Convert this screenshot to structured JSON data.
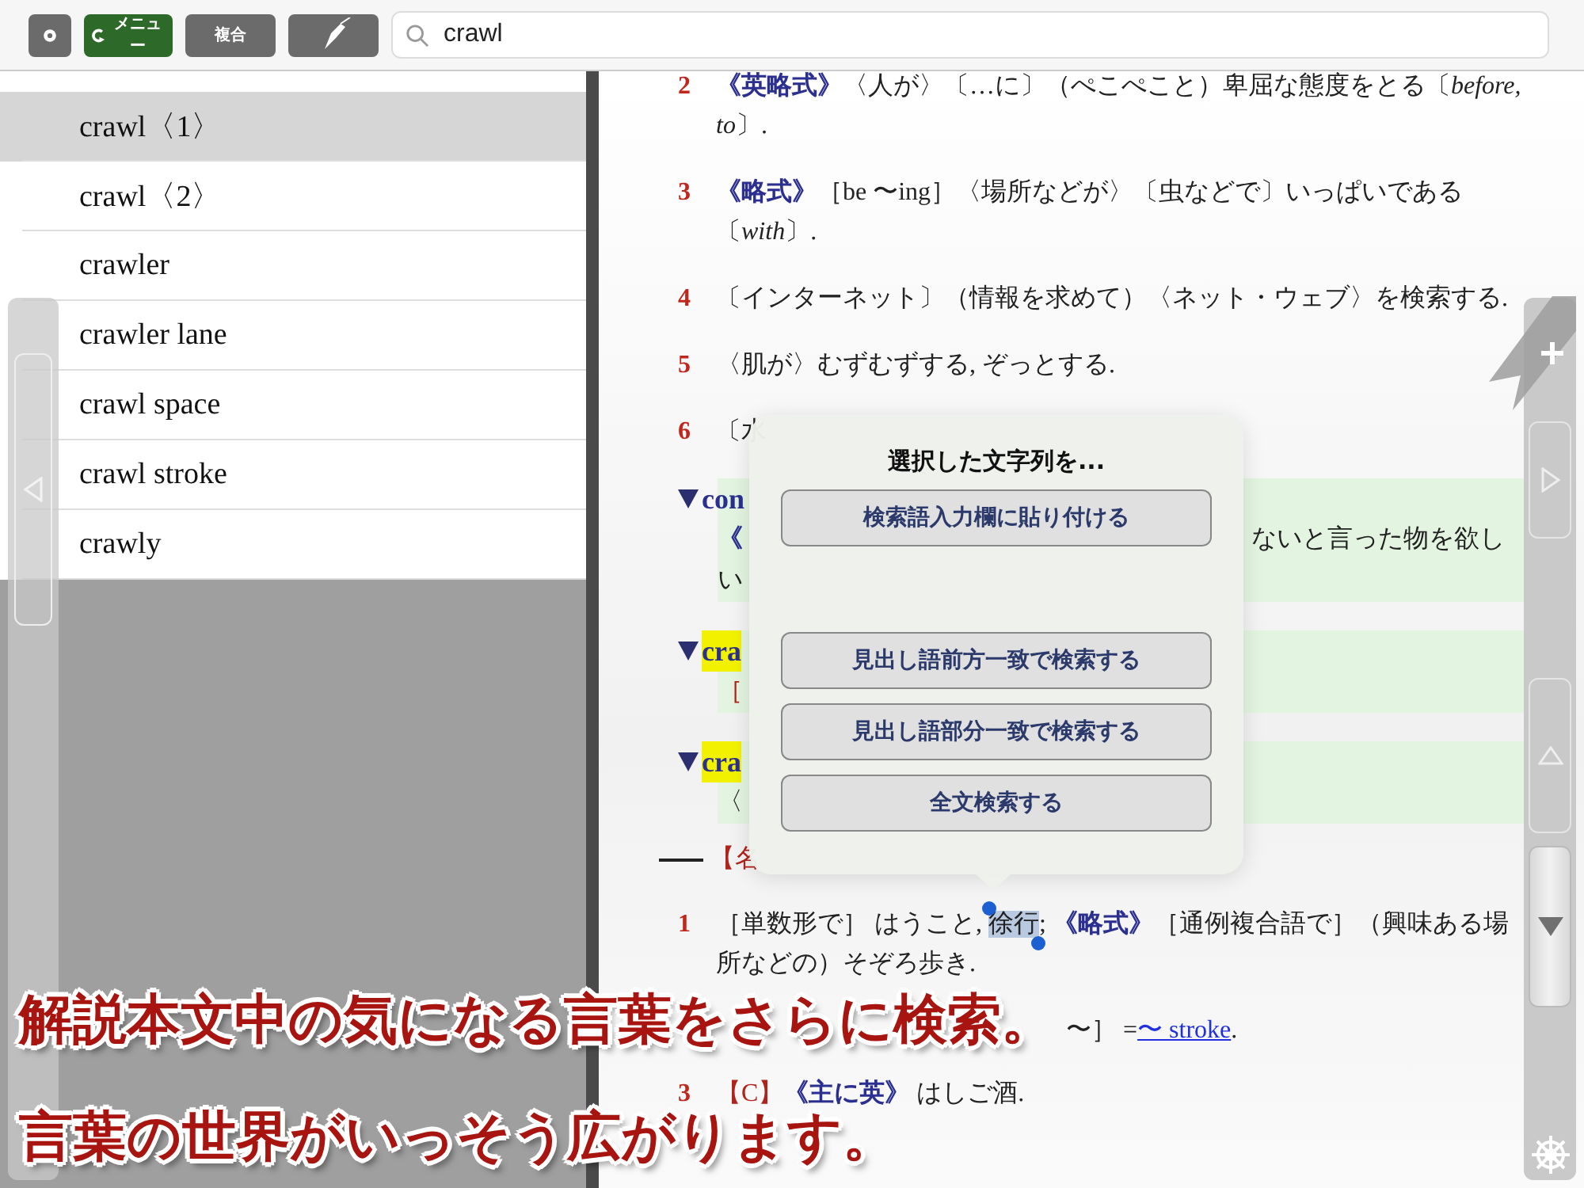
{
  "toolbar": {
    "menu_button": "メニュー",
    "compound_button": "複合",
    "search": {
      "value": "crawl"
    }
  },
  "word_list": [
    {
      "label": "crawl〈1〉",
      "selected": true
    },
    {
      "label": "crawl〈2〉",
      "selected": false
    },
    {
      "label": "crawler",
      "selected": false
    },
    {
      "label": "crawler lane",
      "selected": false
    },
    {
      "label": "crawl space",
      "selected": false
    },
    {
      "label": "crawl stroke",
      "selected": false
    },
    {
      "label": "crawly",
      "selected": false
    }
  ],
  "content": [
    {
      "kind": "sense",
      "number": "2",
      "parts": [
        {
          "kind": "label",
          "text": "《英略式》"
        },
        {
          "kind": "text",
          "text": "〈人が〉〔…に〕（ぺこぺこと）卑屈な態度をとる〔*before,* *to*〕."
        }
      ]
    },
    {
      "kind": "sense",
      "number": "3",
      "parts": [
        {
          "kind": "label",
          "text": "《略式》"
        },
        {
          "kind": "text",
          "text": "［be 〜ing］〈場所などが〉〔虫などで〕いっぱいである〔*with*〕."
        }
      ]
    },
    {
      "kind": "sense",
      "number": "4",
      "parts": [
        {
          "kind": "text",
          "text": "〔インターネット〕（情報を求めて）〈ネット・ウェブ〉を検索する."
        }
      ]
    },
    {
      "kind": "sense",
      "number": "5",
      "parts": [
        {
          "kind": "text",
          "text": "〈肌が〉むずむずする, ぞっとする."
        }
      ]
    },
    {
      "kind": "sense",
      "number": "6",
      "parts": [
        {
          "kind": "text",
          "text": "〔水"
        }
      ]
    },
    {
      "kind": "phrase",
      "heading": "con",
      "highlighted": false,
      "lines": [
        {
          "kind": "label",
          "left": "《",
          "right": "ないと言った物を欲し"
        },
        {
          "kind": "text",
          "left": "い"
        }
      ]
    },
    {
      "kind": "phrase",
      "heading": "cra",
      "highlighted": true,
      "lines": [
        {
          "kind": "grammar",
          "left": "［"
        }
      ]
    },
    {
      "kind": "phrase",
      "heading": "cra",
      "highlighted": true,
      "lines": [
        {
          "kind": "text",
          "left": "〈"
        }
      ]
    },
    {
      "kind": "section",
      "text": "【名"
    },
    {
      "kind": "sense",
      "number": "1",
      "parts": [
        {
          "kind": "text",
          "text": "［単数形で］ はうこと, "
        },
        {
          "kind": "selection",
          "text": "徐行"
        },
        {
          "kind": "text",
          "text": "; "
        },
        {
          "kind": "label",
          "text": "《略式》"
        },
        {
          "kind": "text",
          "text": "［通例複合語で］（興味ある場所などの）そぞろ歩き."
        }
      ]
    },
    {
      "kind": "partial",
      "parts": [
        {
          "kind": "text",
          "text": "〜］ ="
        },
        {
          "kind": "link",
          "text": "〜 stroke"
        },
        {
          "kind": "text",
          "text": "."
        }
      ]
    },
    {
      "kind": "sense",
      "number": "3",
      "parts": [
        {
          "kind": "grammar",
          "text": "【C】"
        },
        {
          "kind": "label",
          "text": "《主に英》"
        },
        {
          "kind": "text",
          "text": " はしご酒."
        }
      ]
    }
  ],
  "popup": {
    "title": "選択した文字列を...",
    "paste_action": "検索語入力欄に貼り付ける",
    "search_actions": [
      "見出し語前方一致で検索する",
      "見出し語部分一致で検索する",
      "全文検索する"
    ]
  },
  "caption": [
    "解説本文中の気になる言葉をさらに検索。",
    "言葉の世界がいっそう広がります。"
  ]
}
